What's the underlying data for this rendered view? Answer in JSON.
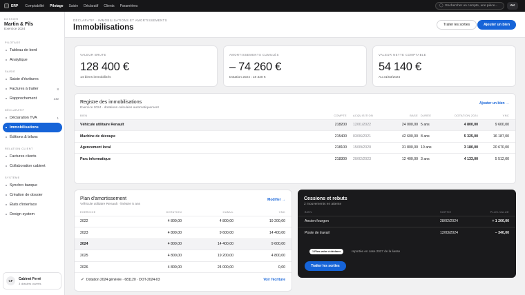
{
  "topbar": {
    "brand": "ERP",
    "nav": [
      "Comptabilité",
      "Pilotage",
      "Saisie",
      "Déclaratif",
      "Clients",
      "Paramètres"
    ],
    "search_placeholder": "Rechercher un compte, une pièce...",
    "avatar": "AK"
  },
  "sidebar": {
    "dossier_caption": "DOSSIER",
    "company": "Martin & Fils",
    "exercise": "Exercice 2024",
    "sections": [
      {
        "label": "PILOTAGE",
        "items": [
          {
            "label": "Tableau de bord",
            "count": ""
          },
          {
            "label": "Analytique",
            "count": ""
          }
        ]
      },
      {
        "label": "SAISIE",
        "items": [
          {
            "label": "Saisie d'écritures",
            "count": ""
          },
          {
            "label": "Factures à traiter",
            "count": "8"
          },
          {
            "label": "Rapprochement",
            "count": "142"
          }
        ]
      },
      {
        "label": "DÉCLARATIF",
        "items": [
          {
            "label": "Déclaration TVA",
            "count": "1"
          },
          {
            "label": "Immobilisations",
            "count": ""
          },
          {
            "label": "Éditions & bilans",
            "count": ""
          }
        ]
      },
      {
        "label": "RELATION CLIENT",
        "items": [
          {
            "label": "Factures clients",
            "count": ""
          },
          {
            "label": "Collaboration cabinet",
            "count": ""
          }
        ]
      },
      {
        "label": "SYSTÈME",
        "items": [
          {
            "label": "Synchro banque",
            "count": ""
          },
          {
            "label": "Création de dossier",
            "count": ""
          },
          {
            "label": "États d'interface",
            "count": ""
          },
          {
            "label": "Design system",
            "count": ""
          }
        ]
      }
    ],
    "footer": {
      "initials": "CF",
      "name": "Cabinet Ferré",
      "sub": "3 dossiers ouverts"
    }
  },
  "header": {
    "breadcrumb": "DÉCLARATIF · IMMOBILISATIONS ET AMORTISSEMENTS",
    "title": "Immobilisations",
    "btn_secondary": "Traiter les sorties",
    "btn_primary": "Ajouter un bien"
  },
  "kpis": [
    {
      "label": "VALEUR BRUTE",
      "value": "128 400 €",
      "sub": "14 biens immobilisés"
    },
    {
      "label": "AMORTISSEMENTS CUMULÉS",
      "value": "– 74 260 €",
      "sub": "Dotation 2024 : 18 320 €"
    },
    {
      "label": "VALEUR NETTE COMPTABLE",
      "value": "54 140 €",
      "sub": "Au 31/03/2024"
    }
  ],
  "registry": {
    "title": "Registre des immobilisations",
    "subtitle": "Exercice 2024 · dotations calculées automatiquement",
    "link": "Ajouter un bien →",
    "columns": [
      "BIEN",
      "COMPTE",
      "ACQUISITION",
      "BASE",
      "DURÉE",
      "DOTATION 2024",
      "VNC"
    ],
    "rows": [
      [
        "Véhicule utilitaire Renault",
        "218200",
        "12/01/2022",
        "24 000,00",
        "5 ans",
        "4 800,00",
        "9 600,00"
      ],
      [
        "Machine de découpe",
        "215400",
        "03/06/2021",
        "42 600,00",
        "8 ans",
        "5 325,00",
        "16 187,00"
      ],
      [
        "Agencement local",
        "218100",
        "15/09/2020",
        "31 800,00",
        "10 ans",
        "3 180,00",
        "20 670,00"
      ],
      [
        "Parc informatique",
        "218300",
        "20/02/2023",
        "12 400,00",
        "3 ans",
        "4 133,00",
        "5 512,00"
      ]
    ]
  },
  "plan": {
    "title": "Plan d'amortissement",
    "subtitle": "Véhicule utilitaire Renault · linéaire 5 ans",
    "link": "Modifier →",
    "columns": [
      "EXERCICE",
      "DOTATION",
      "CUMUL",
      "VNC"
    ],
    "rows": [
      [
        "2022",
        "4 800,00",
        "4 800,00",
        "19 200,00"
      ],
      [
        "2023",
        "4 800,00",
        "9 600,00",
        "14 400,00"
      ],
      [
        "2024",
        "4 800,00",
        "14 400,00",
        "9 600,00"
      ],
      [
        "2025",
        "4 800,00",
        "19 200,00",
        "4 800,00"
      ],
      [
        "2026",
        "4 800,00",
        "24 000,00",
        "0,00"
      ]
    ],
    "footer_text": "Dotation 2024 générée · 681120 · DOT-2024-03",
    "footer_link": "Voir l'écriture"
  },
  "disposals": {
    "title": "Cessions et rebuts",
    "subtitle": "2 mouvements en attente",
    "columns": [
      "BIEN",
      "SORTIE",
      "PLUS-VALUE"
    ],
    "rows": [
      [
        "Ancien fourgon",
        "28/02/2024",
        "+ 1 200,00"
      ],
      [
        "Poste de travail",
        "12/03/2024",
        "– 340,00"
      ]
    ],
    "pill": "1 Plus-value à déclarer",
    "note": "reportée en case 2027 de la liasse",
    "button": "Traiter les sorties"
  }
}
